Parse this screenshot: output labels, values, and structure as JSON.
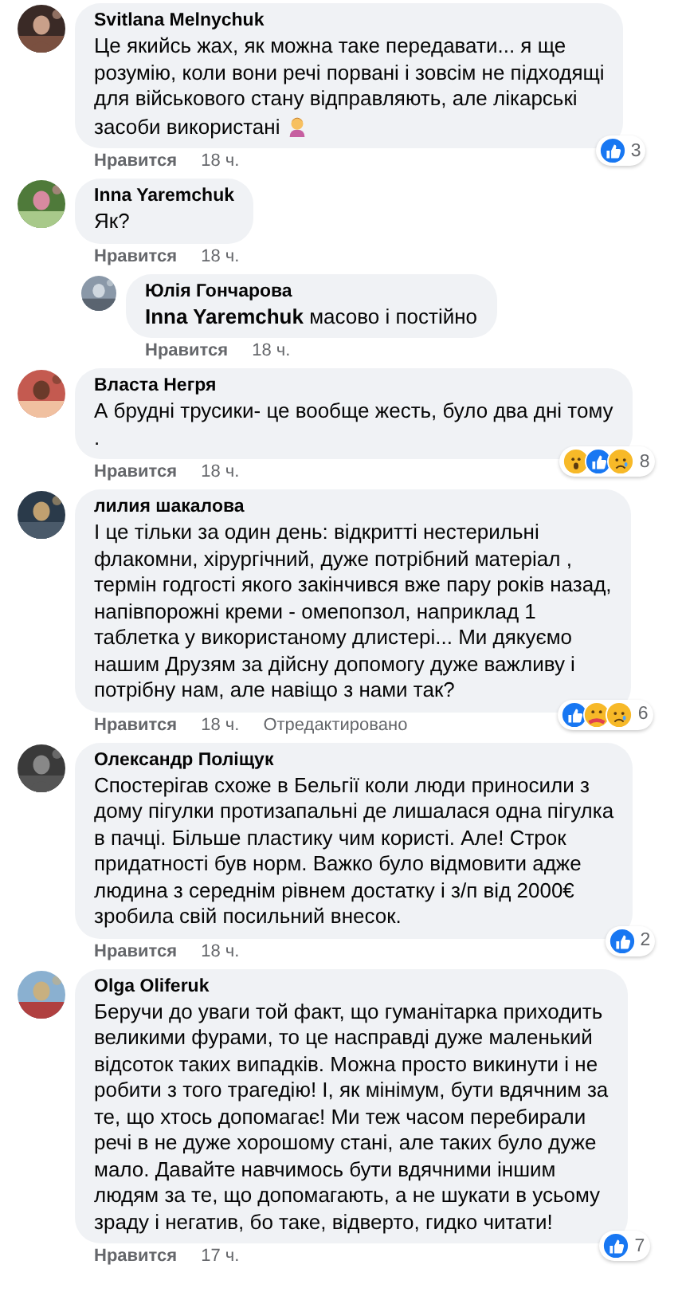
{
  "comments": [
    {
      "author": "Svitlana Melnychuk",
      "lines": [
        "Це якийсь жах, як можна таке передавати... я ще",
        "розумію, коли вони речі порвані і зовсім не підходящі",
        "для військового стану відправляють, але лікарські",
        "засоби використані"
      ],
      "ends_with_emoji": true,
      "like_label": "Нравится",
      "time": "18 ч.",
      "reactions": {
        "icons": [
          {
            "kind": "like"
          }
        ],
        "count": "3"
      }
    },
    {
      "author": "Inna Yaremchuk",
      "lines": [
        "Як?"
      ],
      "like_label": "Нравится",
      "time": "18 ч.",
      "replies": [
        {
          "author": "Юлія Гончарова",
          "lines": [
            "**Inna Yaremchuk** масово і постійно"
          ],
          "like_label": "Нравится",
          "time": "18 ч."
        }
      ]
    },
    {
      "author": "Власта Негря",
      "lines": [
        "А брудні трусики- це вообще жесть, було два дні тому",
        "."
      ],
      "like_label": "Нравится",
      "time": "18 ч.",
      "reactions": {
        "icons": [
          {
            "kind": "wow"
          },
          {
            "kind": "like"
          },
          {
            "kind": "sad"
          }
        ],
        "count": "8"
      }
    },
    {
      "author": "лилия шакалова",
      "lines": [
        "І це тільки за один день: відкритті нестерильні",
        "флакомни, хірургічний, дуже потрібний матеріал ,",
        "термін годгості якого закінчився вже пару років назад,",
        "напівпорожні креми - омепопзол, наприклад 1",
        "таблетка у використаному длистері... Ми дякуємо",
        "нашим Друзям за дійсну допомогу дуже важливу і",
        "потрібну нам, але навіщо з нами так?"
      ],
      "like_label": "Нравится",
      "time": "18 ч.",
      "edited": "Отредактировано",
      "reactions": {
        "icons": [
          {
            "kind": "like"
          },
          {
            "kind": "care"
          },
          {
            "kind": "sad"
          }
        ],
        "count": "6"
      }
    },
    {
      "author": "Олександр Поліщук",
      "lines": [
        "Спостерігав схоже в Бельгії коли люди приносили з",
        "дому пігулки протизапальні де лишалася одна пігулка",
        "в пачці. Більше пластику чим користі. Але! Строк",
        "придатності був норм. Важко було відмовити адже",
        "людина з середнім рівнем достатку і з/п від 2000€",
        "зробила свій посильний внесок."
      ],
      "like_label": "Нравится",
      "time": "18 ч.",
      "reactions": {
        "icons": [
          {
            "kind": "like"
          }
        ],
        "count": "2"
      }
    },
    {
      "author": "Olga Oliferuk",
      "lines": [
        "Беручи до уваги той факт, що гуманітарка приходить",
        "великими фурами, то це насправді дуже маленький",
        "відсоток таких випадків. Можна просто викинути і не",
        "робити з того трагедію! І, як мінімум, бути вдячним за",
        "те, що хтось допомагає! Ми теж часом перебирали",
        "речі в не дуже хорошому стані, але таких було дуже",
        "мало. Давайте навчимось бути вдячними іншим",
        "людям за те, що допомагають, а не шукати в усьому",
        "зраду і негатив, бо таке, відверто, гидко читати!"
      ],
      "like_label": "Нравится",
      "time": "17 ч.",
      "reactions": {
        "icons": [
          {
            "kind": "like"
          }
        ],
        "count": "7"
      }
    }
  ]
}
